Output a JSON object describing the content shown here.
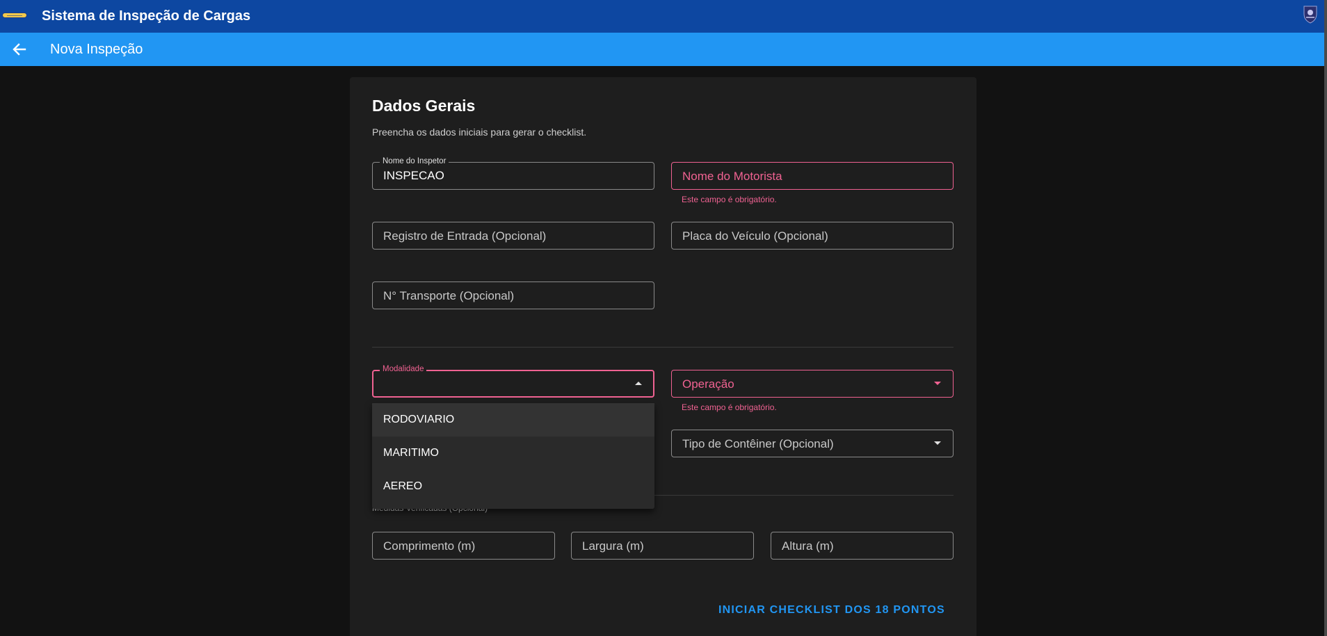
{
  "app": {
    "title": "Sistema de Inspeção de Cargas"
  },
  "subheader": {
    "title": "Nova Inspeção"
  },
  "form": {
    "title": "Dados Gerais",
    "subtitle": "Preencha os dados iniciais para gerar o checklist.",
    "inspector": {
      "label": "Nome do Inspetor",
      "value": "INSPECAO"
    },
    "driver": {
      "placeholder": "Nome do Motorista",
      "error": "Este campo é obrigatório."
    },
    "entry_record": {
      "placeholder": "Registro de Entrada (Opcional)"
    },
    "plate": {
      "placeholder": "Placa do Veículo (Opcional)"
    },
    "transport_number": {
      "placeholder": "N° Transporte (Opcional)"
    },
    "modality": {
      "label": "Modalidade",
      "value": "",
      "options": [
        "RODOVIARIO",
        "MARITIMO",
        "AEREO"
      ],
      "highlighted_option": "RODOVIARIO"
    },
    "operation": {
      "placeholder": "Operação",
      "error": "Este campo é obrigatório."
    },
    "container_type": {
      "placeholder": "Tipo de Contêiner (Opcional)"
    },
    "measurements_section": "Medidas Verificadas (Opcional)",
    "length": {
      "placeholder": "Comprimento (m)"
    },
    "width": {
      "placeholder": "Largura (m)"
    },
    "height": {
      "placeholder": "Altura (m)"
    },
    "submit_label": "INICIAR CHECKLIST DOS 18 PONTOS"
  },
  "colors": {
    "appbar": "#0d47a1",
    "subbar": "#2196f3",
    "card": "#1e1e1e",
    "background": "#121212",
    "error": "#f06292",
    "accent": "#2196f3"
  },
  "icons": {
    "logo": "logo-emblem",
    "crest": "crest-icon",
    "back": "arrow-left-icon",
    "dropdown": "caret-down-icon"
  }
}
